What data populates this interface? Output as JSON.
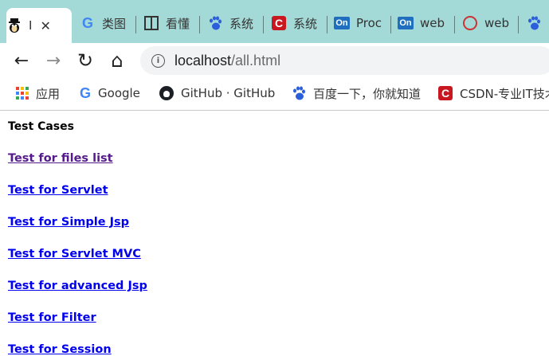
{
  "browser": {
    "tabs": [
      {
        "title": "I",
        "favicon": "penguin-icon",
        "active": true
      },
      {
        "title": "类图",
        "favicon": "google-icon"
      },
      {
        "title": "看懂",
        "favicon": "book-icon"
      },
      {
        "title": "系统",
        "favicon": "baidu-paw-icon"
      },
      {
        "title": "系统",
        "favicon": "csdn-icon"
      },
      {
        "title": "Proc",
        "favicon": "onenote-icon"
      },
      {
        "title": "web",
        "favicon": "onenote-icon"
      },
      {
        "title": "web",
        "favicon": "firefox-icon"
      },
      {
        "title": "",
        "favicon": "baidu-paw-icon"
      }
    ],
    "tab_close_label": "✕",
    "address": {
      "host": "localhost",
      "path": "/all.html"
    },
    "nav": {
      "back": "←",
      "forward": "→",
      "reload": "↻",
      "home": "⌂",
      "info": "i"
    },
    "bookmarks": [
      {
        "label": "应用",
        "favicon": "apps-grid-icon"
      },
      {
        "label": "Google",
        "favicon": "google-icon"
      },
      {
        "label": "GitHub · GitHub",
        "favicon": "github-icon"
      },
      {
        "label": "百度一下，你就知道",
        "favicon": "baidu-paw-icon"
      },
      {
        "label": "CSDN-专业IT技术",
        "favicon": "csdn-icon"
      }
    ],
    "colors": {
      "tabstrip": "#a3d9d6",
      "link": "#0000ee",
      "visited_link": "#551a8b"
    }
  },
  "page": {
    "heading": "Test Cases",
    "links": [
      {
        "label": "Test for files list",
        "visited": true
      },
      {
        "label": "Test for Servlet",
        "visited": false
      },
      {
        "label": "Test for Simple Jsp",
        "visited": false
      },
      {
        "label": "Test for Servlet MVC",
        "visited": false
      },
      {
        "label": "Test for advanced Jsp",
        "visited": false
      },
      {
        "label": "Test for Filter",
        "visited": false
      },
      {
        "label": "Test for Session",
        "visited": false
      }
    ]
  }
}
